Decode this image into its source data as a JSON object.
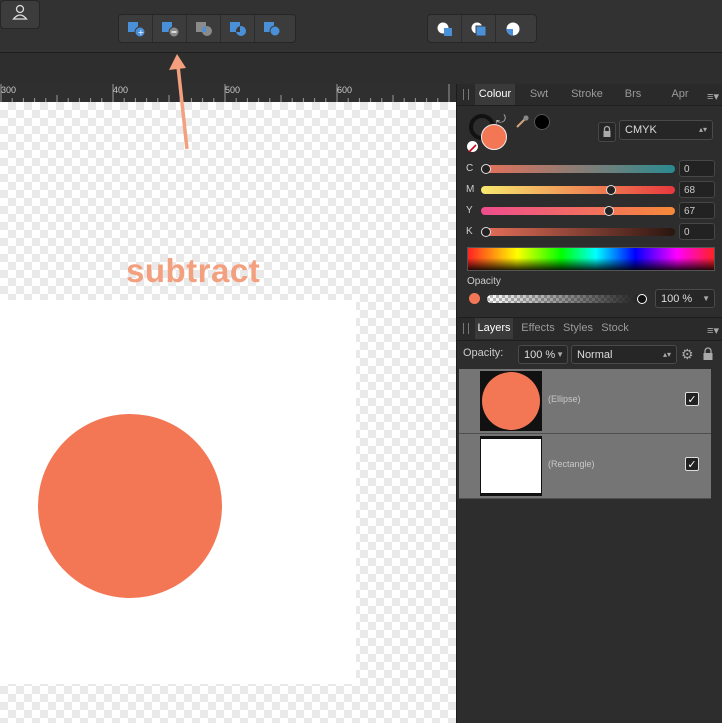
{
  "toolbar": {
    "boolean_ops": [
      "add-icon",
      "subtract-icon",
      "intersect-icon",
      "xor-icon",
      "divide-icon"
    ],
    "geometry_ops": [
      "combine-icon",
      "separate-icon",
      "quarter-icon"
    ],
    "user_icon": "person-icon"
  },
  "ruler": {
    "labels": [
      "300",
      "400",
      "500",
      "600"
    ]
  },
  "annotation": {
    "text": "subtract"
  },
  "colour_panel": {
    "tabs": [
      "Colour",
      "Swt",
      "Stroke",
      "Brs",
      "Apr"
    ],
    "active_tab": "Colour",
    "model": "CMYK",
    "sliders": [
      {
        "label": "C",
        "value": "0",
        "fraction": 0.0
      },
      {
        "label": "M",
        "value": "68",
        "fraction": 0.68
      },
      {
        "label": "Y",
        "value": "67",
        "fraction": 0.67
      },
      {
        "label": "K",
        "value": "0",
        "fraction": 0.0
      }
    ],
    "opacity_label": "Opacity",
    "opacity_value": "100 %",
    "fill_color": "#f47755"
  },
  "layers_panel": {
    "tabs": [
      "Layers",
      "Effects",
      "Styles",
      "Stock"
    ],
    "active_tab": "Layers",
    "opacity_label": "Opacity:",
    "opacity_value": "100 %",
    "blend_mode": "Normal",
    "layers": [
      {
        "name": "(Ellipse)",
        "visible": "✓"
      },
      {
        "name": "(Rectangle)",
        "visible": "✓"
      }
    ]
  }
}
